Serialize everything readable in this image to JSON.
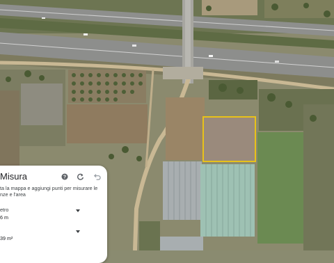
{
  "map": {
    "type": "satellite",
    "highlight_color": "#e8c21a"
  },
  "measure_panel": {
    "title": "Misura",
    "icons": [
      "help-icon",
      "refresh-icon",
      "undo-icon"
    ],
    "instructions": "ta la mappa e aggiungi punti per misurare le nze e l'area",
    "perimeter": {
      "label": "etro",
      "value": "6 m"
    },
    "area": {
      "value": "39 m²"
    }
  }
}
